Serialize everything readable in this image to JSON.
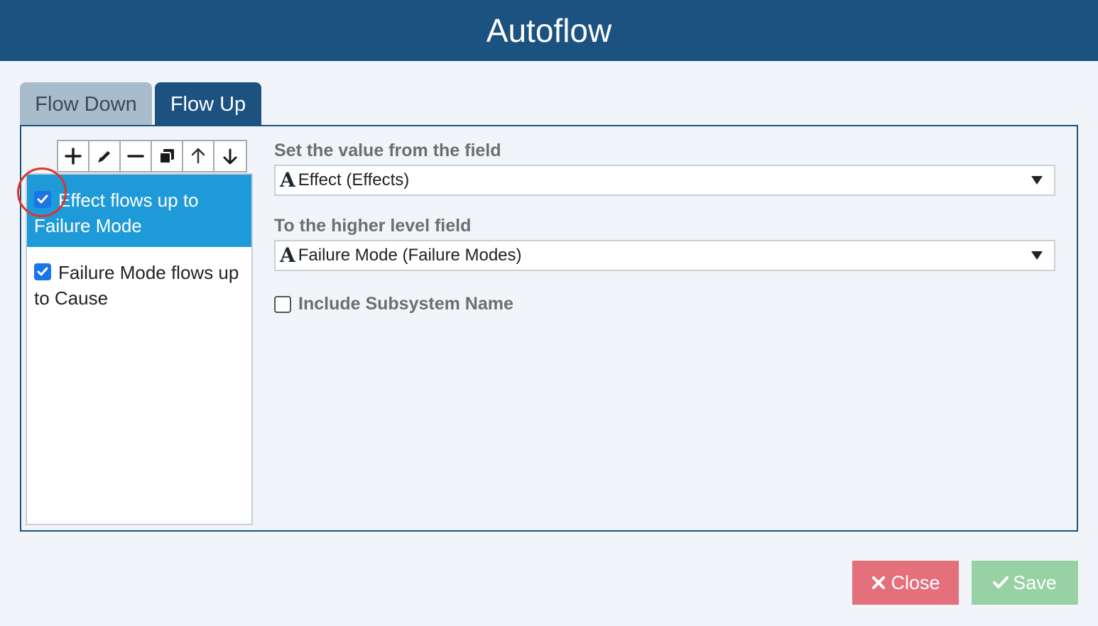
{
  "window": {
    "title": "Autoflow"
  },
  "tabs": [
    {
      "label": "Flow Down",
      "active": false
    },
    {
      "label": "Flow Up",
      "active": true
    }
  ],
  "toolbar": {
    "buttons": [
      "plus-icon",
      "pencil-icon",
      "minus-icon",
      "copy-icon",
      "arrow-up-icon",
      "arrow-down-icon"
    ]
  },
  "rules": {
    "items": [
      {
        "label": "Effect flows up to Failure Mode",
        "checked": true,
        "selected": true
      },
      {
        "label": "Failure Mode flows up to Cause",
        "checked": true,
        "selected": false
      }
    ]
  },
  "form": {
    "source_label": "Set the value from the field",
    "source_value": "Effect (Effects)",
    "target_label": "To the higher level field",
    "target_value": "Failure Mode (Failure Modes)",
    "include_subsystem_label": "Include Subsystem Name",
    "include_subsystem_checked": false
  },
  "footer": {
    "close_label": "Close",
    "save_label": "Save"
  },
  "colors": {
    "header": "#1b5280",
    "selected_item": "#1f9ad9",
    "close_button": "#e4707c",
    "save_button": "#98d2a4"
  }
}
